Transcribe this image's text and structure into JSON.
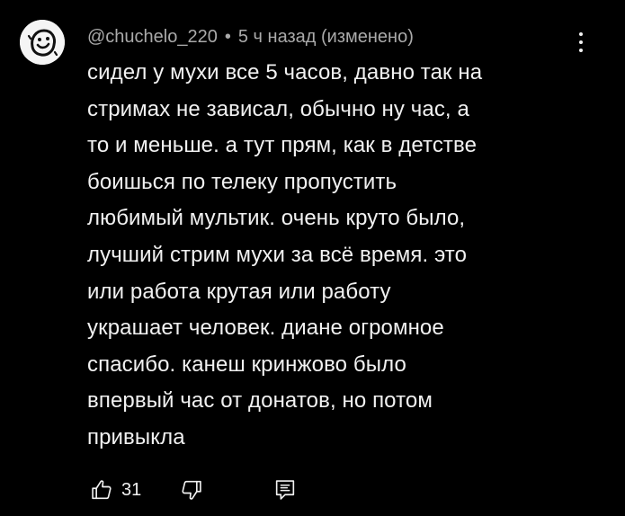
{
  "comment": {
    "author": "@chuchelo_220",
    "separator": "•",
    "timestamp": "5 ч назад (изменено)",
    "lines": [
      "сидел у мухи все 5 часов, давно так на",
      "стримах не зависал, обычно ну час, а",
      "то и меньше. а тут прям, как в детстве",
      "боишься по телеку пропустить",
      "любимый мультик. очень круто было,",
      "лучший стрим мухи за всё время. это",
      "или работа крутая или работу",
      "украшает человек. диане огромное",
      "спасибо. канеш кринжово было",
      "впервый час от донатов, но потом",
      "привыкла"
    ],
    "like_count": "31"
  },
  "icons": {
    "avatar": "smiley-face-avatar",
    "menu": "more-vertical-icon",
    "like": "thumb-up-icon",
    "dislike": "thumb-down-icon",
    "reply": "reply-comment-icon"
  },
  "colors": {
    "background": "#000000",
    "text": "#f1f1f1",
    "secondary_text": "#aaaaaa",
    "avatar_bg": "#f5f5f5"
  }
}
